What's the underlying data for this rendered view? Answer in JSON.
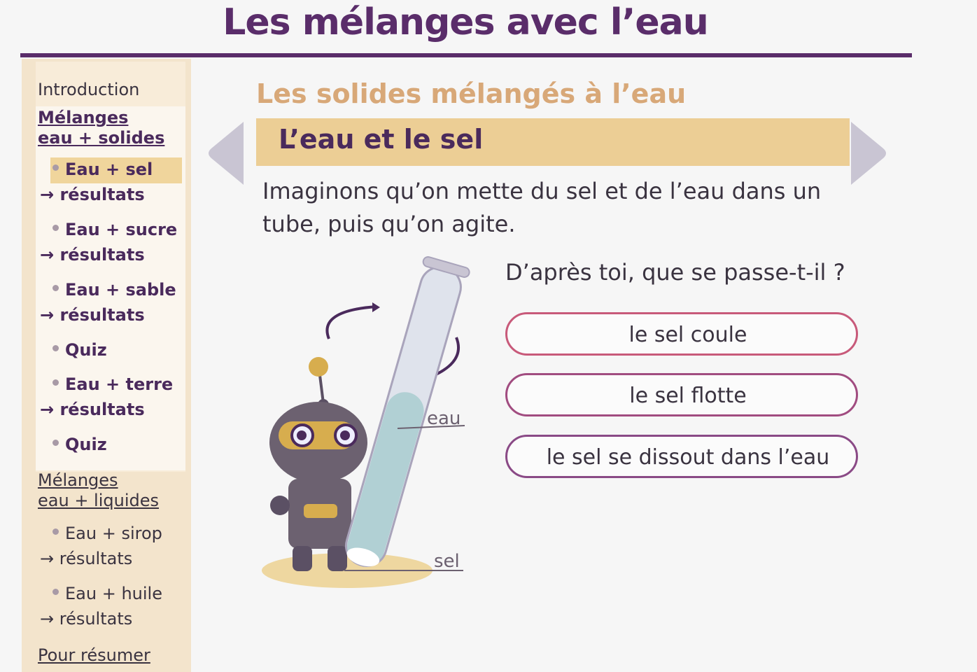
{
  "page": {
    "title": "Les mélanges avec l’eau"
  },
  "sidebar": {
    "intro": "Introduction",
    "solids_line1": "Mélanges",
    "solids_line2": "eau + solides",
    "solids_items": [
      {
        "label": "Eau + sel",
        "result": "→ résultats"
      },
      {
        "label": "Eau + sucre",
        "result": "→ résultats"
      },
      {
        "label": "Eau + sable",
        "result": "→ résultats"
      },
      {
        "label": "Quiz"
      },
      {
        "label": "Eau + terre",
        "result": "→ résultats"
      },
      {
        "label": "Quiz"
      }
    ],
    "liquids_line1": "Mélanges",
    "liquids_line2": "eau + liquides",
    "liquids_items": [
      {
        "label": "Eau + sirop",
        "result": "→ résultats"
      },
      {
        "label": "Eau + huile",
        "result": "→ résultats"
      }
    ],
    "summary": "Pour résumer"
  },
  "content": {
    "section_title": "Les solides mélangés à l’eau",
    "banner_title": "L’eau et le sel",
    "intro": "Imaginons qu’on mette du sel et de l’eau dans un tube, puis qu’on agite.",
    "question": "D’après toi, que se passe-t-il ?",
    "answers": [
      "le sel coule",
      "le sel flotte",
      "le sel se dissout dans l’eau"
    ]
  },
  "illustration": {
    "label_water": "eau",
    "label_salt": "sel"
  },
  "colors": {
    "brand": "#5a2d6a",
    "banner": "#ecce95",
    "section": "#d8a878",
    "sidebar": "#f3e4cc"
  }
}
